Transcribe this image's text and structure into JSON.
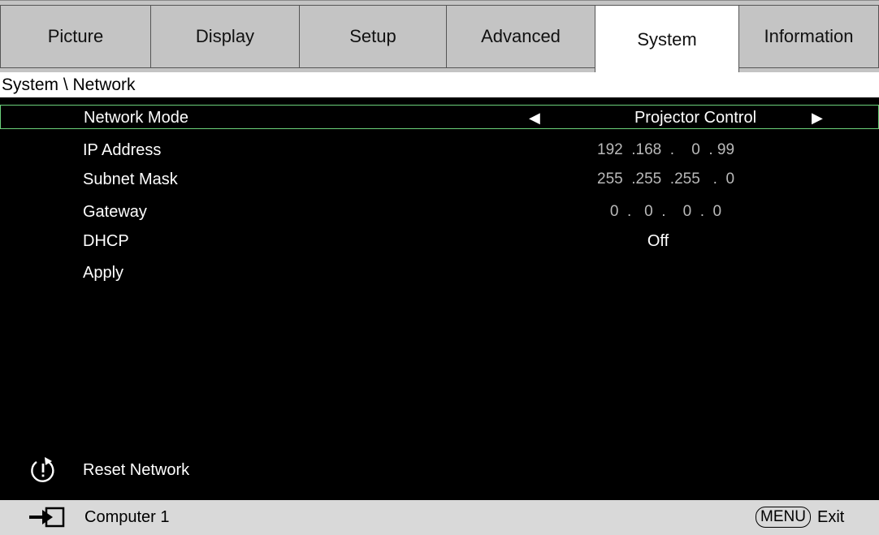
{
  "tabs": [
    {
      "label": "Picture"
    },
    {
      "label": "Display"
    },
    {
      "label": "Setup"
    },
    {
      "label": "Advanced"
    },
    {
      "label": "System"
    },
    {
      "label": "Information"
    }
  ],
  "active_tab": "System",
  "breadcrumb": "System \\ Network",
  "menu": {
    "network_mode": {
      "label": "Network Mode",
      "value": "Projector Control"
    },
    "ip_address": {
      "label": "IP Address",
      "value": "192  .168  .    0  . 99"
    },
    "subnet_mask": {
      "label": "Subnet Mask",
      "value": "255  .255  .255   .  0"
    },
    "gateway": {
      "label": "Gateway",
      "value": "   0  .   0  .    0  .  0"
    },
    "dhcp": {
      "label": "DHCP",
      "value": "Off"
    },
    "apply": {
      "label": "Apply"
    },
    "reset": {
      "label": "Reset Network"
    }
  },
  "footer": {
    "source": "Computer 1",
    "menu_key": "MENU",
    "exit": "Exit"
  },
  "colors": {
    "background": "#000000",
    "tab_bar": "#c4c4c4",
    "active_tab": "#ffffff",
    "selection_border": "#6bd07a",
    "ip_text": "#b9b9b9",
    "footer": "#d9d9d9"
  },
  "icons": {
    "left_arrow": "triangle-left-icon",
    "right_arrow": "triangle-right-icon",
    "reset": "reset-power-icon",
    "input": "input-source-icon"
  }
}
